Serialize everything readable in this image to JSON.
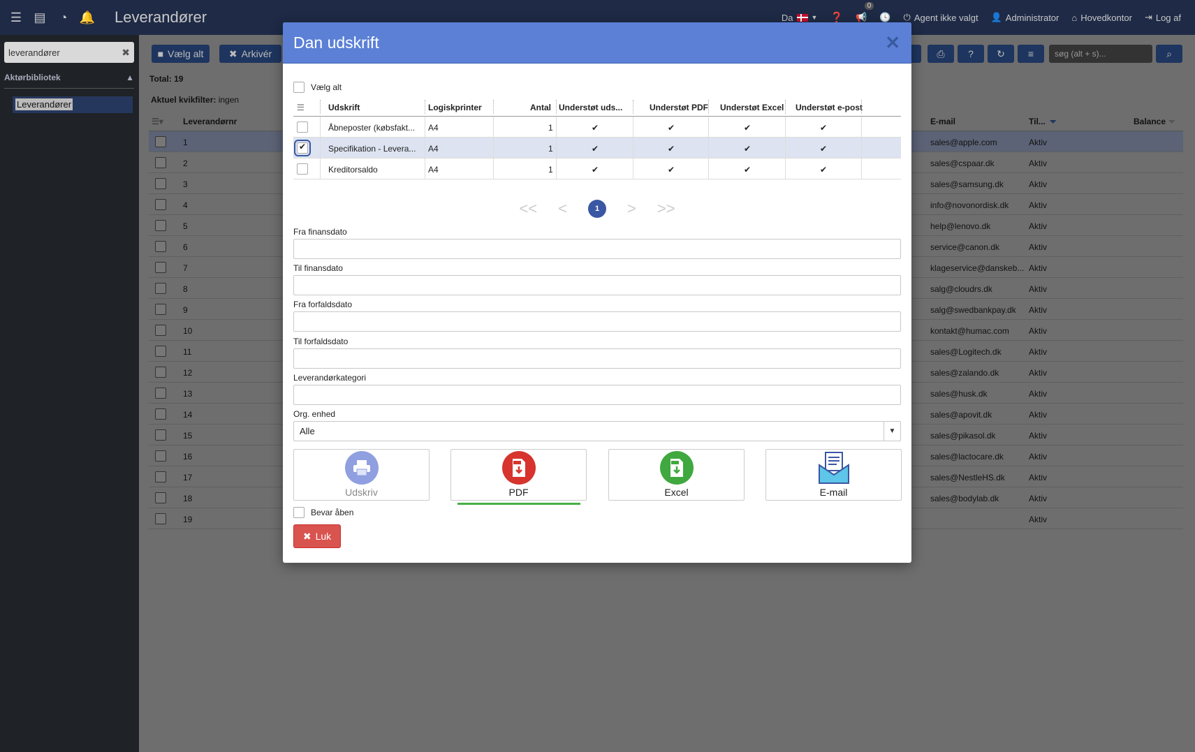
{
  "topbar": {
    "app_title": "Leverandører",
    "language": "Da",
    "notification_count": "0",
    "agent": "Agent ikke valgt",
    "user": "Administrator",
    "office": "Hovedkontor",
    "logout": "Log af"
  },
  "sidebar": {
    "search_value": "leverandører",
    "section_title": "Aktørbibliotek",
    "item": "Leverandører"
  },
  "toolbar": {
    "select_all": "Vælg alt",
    "archive": "Arkivér",
    "search_placeholder": "søg (alt + s)..."
  },
  "list": {
    "total": "Total: 19",
    "quickfilter_label": "Aktuel kvikfilter:",
    "quickfilter_value": "ingen",
    "columns": {
      "nr": "Leverandørnr",
      "email": "E-mail",
      "status": "Til...",
      "balance": "Balance"
    },
    "rows": [
      {
        "nr": "1",
        "email": "sales@apple.com",
        "status": "Aktiv"
      },
      {
        "nr": "2",
        "email": "sales@cspaar.dk",
        "status": "Aktiv"
      },
      {
        "nr": "3",
        "email": "sales@samsung.dk",
        "status": "Aktiv"
      },
      {
        "nr": "4",
        "email": "info@novonordisk.dk",
        "status": "Aktiv"
      },
      {
        "nr": "5",
        "email": "help@lenovo.dk",
        "status": "Aktiv"
      },
      {
        "nr": "6",
        "email": "service@canon.dk",
        "status": "Aktiv"
      },
      {
        "nr": "7",
        "email": "klageservice@danskeb...",
        "status": "Aktiv"
      },
      {
        "nr": "8",
        "email": "salg@cloudrs.dk",
        "status": "Aktiv"
      },
      {
        "nr": "9",
        "email": "salg@swedbankpay.dk",
        "status": "Aktiv"
      },
      {
        "nr": "10",
        "email": "kontakt@humac.com",
        "status": "Aktiv"
      },
      {
        "nr": "11",
        "email": "sales@Logitech.dk",
        "status": "Aktiv"
      },
      {
        "nr": "12",
        "email": "sales@zalando.dk",
        "status": "Aktiv"
      },
      {
        "nr": "13",
        "email": "sales@husk.dk",
        "status": "Aktiv"
      },
      {
        "nr": "14",
        "email": "sales@apovit.dk",
        "status": "Aktiv"
      },
      {
        "nr": "15",
        "email": "sales@pikasol.dk",
        "status": "Aktiv"
      },
      {
        "nr": "16",
        "email": "sales@lactocare.dk",
        "status": "Aktiv"
      },
      {
        "nr": "17",
        "email": "sales@NestleHS.dk",
        "status": "Aktiv"
      },
      {
        "nr": "18",
        "email": "sales@bodylab.dk",
        "status": "Aktiv"
      },
      {
        "nr": "19",
        "email": "",
        "status": "Aktiv"
      }
    ]
  },
  "modal": {
    "title": "Dan udskrift",
    "select_all": "Vælg alt",
    "columns": {
      "udskrift": "Udskrift",
      "printer": "Logiskprinter",
      "antal": "Antal",
      "uds": "Understøt uds...",
      "pdf": "Understøt PDF",
      "excel": "Understøt Excel",
      "epost": "Understøt e-post"
    },
    "rows": [
      {
        "name": "Åbneposter (købsfakt...",
        "printer": "A4",
        "antal": "1",
        "checked": false
      },
      {
        "name": "Specifikation - Levera...",
        "printer": "A4",
        "antal": "1",
        "checked": true
      },
      {
        "name": "Kreditorsaldo",
        "printer": "A4",
        "antal": "1",
        "checked": false
      }
    ],
    "pager": {
      "first": "<<",
      "prev": "<",
      "current": "1",
      "next": ">",
      "last": ">>"
    },
    "fields": {
      "fra_finansdato": "Fra finansdato",
      "til_finansdato": "Til finansdato",
      "fra_forfaldsdato": "Fra forfaldsdato",
      "til_forfaldsdato": "Til forfaldsdato",
      "kategori": "Leverandørkategori",
      "org_label": "Org. enhed",
      "org_value": "Alle"
    },
    "actions": {
      "print": "Udskriv",
      "pdf": "PDF",
      "excel": "Excel",
      "email": "E-mail"
    },
    "keep_open": "Bevar åben",
    "close": "Luk",
    "colors": {
      "header": "#5b80d6",
      "close_btn": "#d9534f",
      "pdf": "#d6342d",
      "excel": "#3fa83f",
      "print": "#8f9fe0",
      "email": "#3a57a3"
    }
  }
}
